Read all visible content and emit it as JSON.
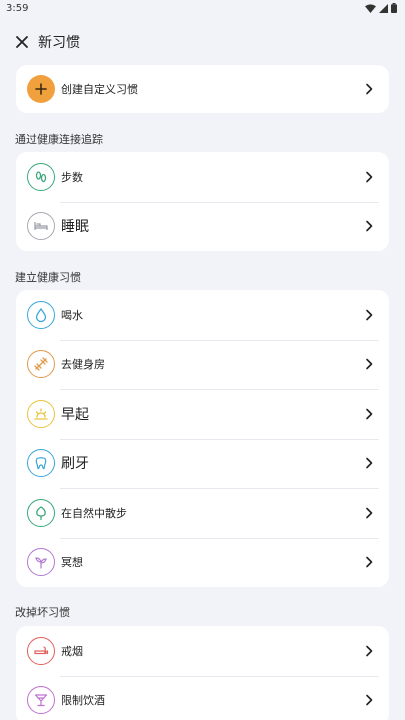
{
  "status_bar": {
    "time": "3:59"
  },
  "header": {
    "title": "新习惯"
  },
  "create_custom": {
    "label": "创建自定义习惯"
  },
  "sections": [
    {
      "title": "通过健康连接追踪",
      "items": [
        {
          "label": "步数",
          "icon": "footprints-icon",
          "color": "#3aa87a"
        },
        {
          "label": "睡眠",
          "icon": "bed-icon",
          "color": "#9a9aa8"
        }
      ]
    },
    {
      "title": "建立健康习惯",
      "items": [
        {
          "label": "喝水",
          "icon": "water-drop-icon",
          "color": "#3aa6d8"
        },
        {
          "label": "去健身房",
          "icon": "dumbbell-icon",
          "color": "#e09a4a"
        },
        {
          "label": "早起",
          "icon": "sunrise-icon",
          "color": "#e8c43a"
        },
        {
          "label": "刷牙",
          "icon": "tooth-icon",
          "color": "#3aa6d8"
        },
        {
          "label": "在自然中散步",
          "icon": "tree-icon",
          "color": "#3aa87a"
        },
        {
          "label": "冥想",
          "icon": "sprout-icon",
          "color": "#b07ad0"
        }
      ]
    },
    {
      "title": "改掉坏习惯",
      "items": [
        {
          "label": "戒烟",
          "icon": "no-smoking-icon",
          "color": "#e0605a"
        },
        {
          "label": "限制饮酒",
          "icon": "cocktail-icon",
          "color": "#c070d0"
        }
      ]
    }
  ],
  "colors": {
    "background": "#f2f3f8",
    "card": "#ffffff",
    "add_button": "#f0a03c"
  }
}
